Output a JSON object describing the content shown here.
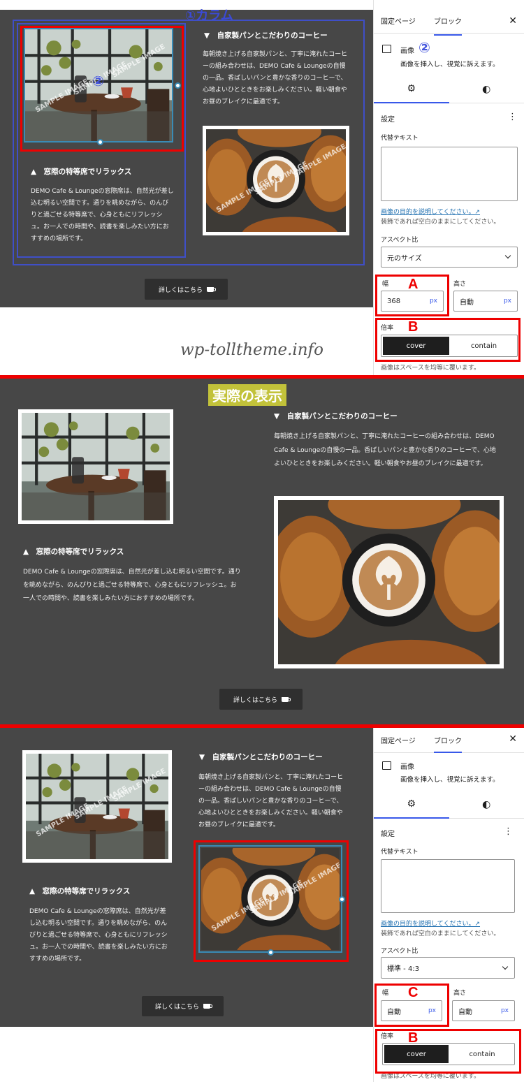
{
  "annotations": {
    "column_label": "①カラム",
    "image_label_num": "②",
    "block_num": "②",
    "actual_label": "実際の表示",
    "letter_a": "A",
    "letter_b": "B",
    "letter_c": "C",
    "watermark": "wp-tolltheme.info"
  },
  "content": {
    "heading_right": "▼　自家製パンとこだわりのコーヒー",
    "para_right": "毎朝焼き上げる自家製パンと、丁寧に淹れたコーヒーの組み合わせは、DEMO Cafe & Loungeの自慢の一品。香ばしいパンと豊かな香りのコーヒーで、心地よいひとときをお楽しみください。軽い朝食やお昼のブレイクに最適です。",
    "heading_left": "▲　窓際の特等席でリラックス",
    "para_left": "DEMO Cafe & Loungeの窓際席は、自然光が差し込む明るい空間です。通りを眺めながら、のんびりと過ごせる特等席で、心身ともにリフレッシュ。お一人での時間や、読書を楽しみたい方におすすめの場所です。",
    "button_label": "詳しくはこちら",
    "sample_text": "SAMPLE IMAGE"
  },
  "sidebar": {
    "tab_page": "固定ページ",
    "tab_block": "ブロック",
    "close": "✕",
    "block_name": "画像",
    "block_desc": "画像を挿入し、視覚に訴えます。",
    "settings_title": "設定",
    "menu_dots": "⋮",
    "alt_label": "代替テキスト",
    "alt_link": "画像の目的を説明してください。↗",
    "alt_help": "装飾であれば空白のままにしてください。",
    "aspect_label": "アスペクト比",
    "width_label": "幅",
    "height_label": "高さ",
    "scale_label": "倍率",
    "cover": "cover",
    "contain": "contain",
    "scale_help": "画像はスペースを均等に覆います。",
    "unit": "px",
    "panel1": {
      "aspect_value": "元のサイズ",
      "width_value": "368",
      "height_value": "自動"
    },
    "panel2": {
      "aspect_value": "標準 - 4:3",
      "width_value": "自動",
      "height_value": "自動"
    }
  }
}
